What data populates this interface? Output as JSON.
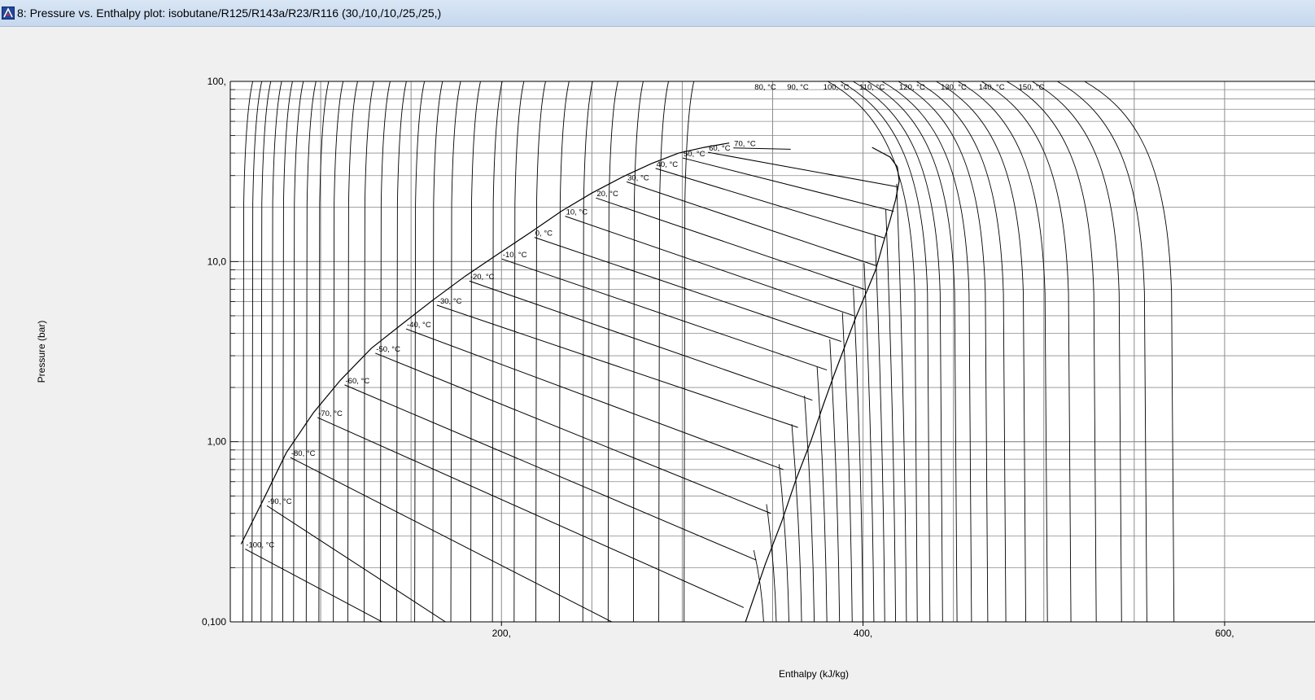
{
  "window": {
    "title": "8: Pressure vs. Enthalpy plot: isobutane/R125/R143a/R23/R116 (30,/10,/10,/25,/25,)",
    "icon": "refprop-app-icon"
  },
  "colors": {
    "background": "#f0f0f0",
    "plot_background": "#ffffff",
    "grid": "#8c8c8c",
    "curve": "#000000"
  },
  "chart_data": {
    "type": "line",
    "xlabel": "Enthalpy (kJ/kg)",
    "ylabel": "Pressure (bar)",
    "x_scale": "linear",
    "y_scale": "log",
    "xlim": [
      50,
      650
    ],
    "ylim": [
      0.1,
      100
    ],
    "grid": true,
    "legend": "none",
    "x_ticks": [
      {
        "value": 200,
        "label": "200,"
      },
      {
        "value": 400,
        "label": "400,"
      },
      {
        "value": 600,
        "label": "600,"
      }
    ],
    "y_ticks": [
      {
        "value": 0.1,
        "label": "0,100"
      },
      {
        "value": 1,
        "label": "1,00"
      },
      {
        "value": 10,
        "label": "10,0"
      },
      {
        "value": 100,
        "label": "100,"
      }
    ],
    "saturated_liquid_line": {
      "h": [
        56,
        68,
        81,
        96,
        111,
        128,
        145,
        162,
        180,
        198,
        216,
        233,
        250,
        267,
        283,
        298,
        312,
        326
      ],
      "p": [
        0.27,
        0.47,
        0.87,
        1.45,
        2.2,
        3.3,
        4.5,
        6.1,
        8.3,
        11.0,
        14.5,
        19.0,
        24.0,
        29.5,
        35.0,
        40.0,
        43.0,
        45.5
      ]
    },
    "saturated_vapor_line": {
      "h": [
        335,
        346,
        355,
        363,
        371,
        378,
        384,
        390,
        396,
        402,
        407,
        411,
        415,
        418,
        420,
        419,
        415,
        405
      ],
      "p": [
        0.1,
        0.21,
        0.36,
        0.62,
        1.0,
        1.6,
        2.35,
        3.4,
        4.9,
        6.8,
        9.0,
        12.5,
        17.0,
        22.0,
        28.0,
        33.5,
        38.0,
        43.0
      ]
    },
    "isotherms_two_phase": [
      {
        "label": "-100, °C",
        "h_liq": 56,
        "p_liq": 0.27,
        "h_vap": 134,
        "p_vap": 0.1
      },
      {
        "label": "-90, °C",
        "h_liq": 68,
        "p_liq": 0.47,
        "h_vap": 169,
        "p_vap": 0.1
      },
      {
        "label": "-80, °C",
        "h_liq": 81,
        "p_liq": 0.87,
        "h_vap": 261,
        "p_vap": 0.1
      },
      {
        "label": "-70, °C",
        "h_liq": 96,
        "p_liq": 1.45,
        "h_vap": 334,
        "p_vap": 0.12
      },
      {
        "label": "-60, °C",
        "h_liq": 111,
        "p_liq": 2.2,
        "h_vap": 341,
        "p_vap": 0.22
      },
      {
        "label": "-50, °C",
        "h_liq": 128,
        "p_liq": 3.3,
        "h_vap": 349,
        "p_vap": 0.4
      },
      {
        "label": "-40, °C",
        "h_liq": 145,
        "p_liq": 4.5,
        "h_vap": 356,
        "p_vap": 0.7
      },
      {
        "label": "-30, °C",
        "h_liq": 162,
        "p_liq": 6.1,
        "h_vap": 364,
        "p_vap": 1.2
      },
      {
        "label": "-20, °C",
        "h_liq": 180,
        "p_liq": 8.3,
        "h_vap": 372,
        "p_vap": 1.7
      },
      {
        "label": "-10, °C",
        "h_liq": 198,
        "p_liq": 11.0,
        "h_vap": 380,
        "p_vap": 2.5
      },
      {
        "label": "0, °C",
        "h_liq": 216,
        "p_liq": 14.5,
        "h_vap": 388,
        "p_vap": 3.6
      },
      {
        "label": "10, °C",
        "h_liq": 233,
        "p_liq": 19.0,
        "h_vap": 395,
        "p_vap": 5.0
      },
      {
        "label": "20, °C",
        "h_liq": 250,
        "p_liq": 24.0,
        "h_vap": 401,
        "p_vap": 7.0
      },
      {
        "label": "30, °C",
        "h_liq": 267,
        "p_liq": 29.5,
        "h_vap": 407,
        "p_vap": 9.5
      },
      {
        "label": "40, °C",
        "h_liq": 283,
        "p_liq": 35.0,
        "h_vap": 412,
        "p_vap": 13.5
      },
      {
        "label": "50, °C",
        "h_liq": 298,
        "p_liq": 40.0,
        "h_vap": 417,
        "p_vap": 19.0
      },
      {
        "label": "60, °C",
        "h_liq": 312,
        "p_liq": 43.0,
        "h_vap": 419,
        "p_vap": 26.0
      },
      {
        "label": "70, °C",
        "h_liq": 326,
        "p_liq": 45.5,
        "h_vap": 360,
        "p_vap": 42.0
      }
    ],
    "isotherms_liquid_h": [
      57,
      62,
      67,
      73,
      79,
      85,
      92,
      99,
      107,
      115,
      124,
      133,
      142,
      152,
      162,
      172,
      183,
      195,
      207,
      219,
      232,
      245,
      259,
      273,
      287,
      301
    ],
    "isotherms_vapor": [
      {
        "h_bottom": 345,
        "p_top": 0.25
      },
      {
        "h_bottom": 352,
        "p_top": 0.45
      },
      {
        "h_bottom": 359,
        "p_top": 0.75
      },
      {
        "h_bottom": 366,
        "p_top": 1.25
      },
      {
        "h_bottom": 373,
        "p_top": 1.8
      },
      {
        "h_bottom": 380,
        "p_top": 2.6
      },
      {
        "h_bottom": 387,
        "p_top": 3.7
      },
      {
        "h_bottom": 394,
        "p_top": 5.2
      },
      {
        "h_bottom": 400,
        "p_top": 7.2
      },
      {
        "h_bottom": 406,
        "p_top": 9.8
      },
      {
        "h_bottom": 412,
        "p_top": 14.0
      },
      {
        "h_bottom": 418,
        "p_top": 19.5
      },
      {
        "h_bottom": 424,
        "p_top": 27.0
      },
      {
        "h_bottom": 430,
        "p_top": 100
      },
      {
        "h_bottom": 437,
        "p_top": 100
      },
      {
        "h_bottom": 444,
        "p_top": 100
      },
      {
        "h_bottom": 452,
        "p_top": 100
      },
      {
        "h_bottom": 460,
        "p_top": 100
      },
      {
        "h_bottom": 469,
        "p_top": 100
      },
      {
        "h_bottom": 479,
        "p_top": 100
      },
      {
        "h_bottom": 490,
        "p_top": 100
      },
      {
        "h_bottom": 502,
        "p_top": 100
      },
      {
        "h_bottom": 515,
        "p_top": 100
      },
      {
        "h_bottom": 529,
        "p_top": 100
      },
      {
        "h_bottom": 543,
        "p_top": 100
      },
      {
        "h_bottom": 557,
        "p_top": 100
      },
      {
        "h_bottom": 572,
        "p_top": 100
      }
    ],
    "isotherms_supercritical": [
      {
        "label": "80, °C",
        "h_top": 340
      },
      {
        "label": "90, °C",
        "h_top": 358
      },
      {
        "label": "100, °C",
        "h_top": 378
      },
      {
        "label": "110, °C",
        "h_top": 398
      },
      {
        "label": "120, °C",
        "h_top": 420
      },
      {
        "label": "130, °C",
        "h_top": 443
      },
      {
        "label": "140, °C",
        "h_top": 464
      },
      {
        "label": "150, °C",
        "h_top": 486
      }
    ]
  }
}
